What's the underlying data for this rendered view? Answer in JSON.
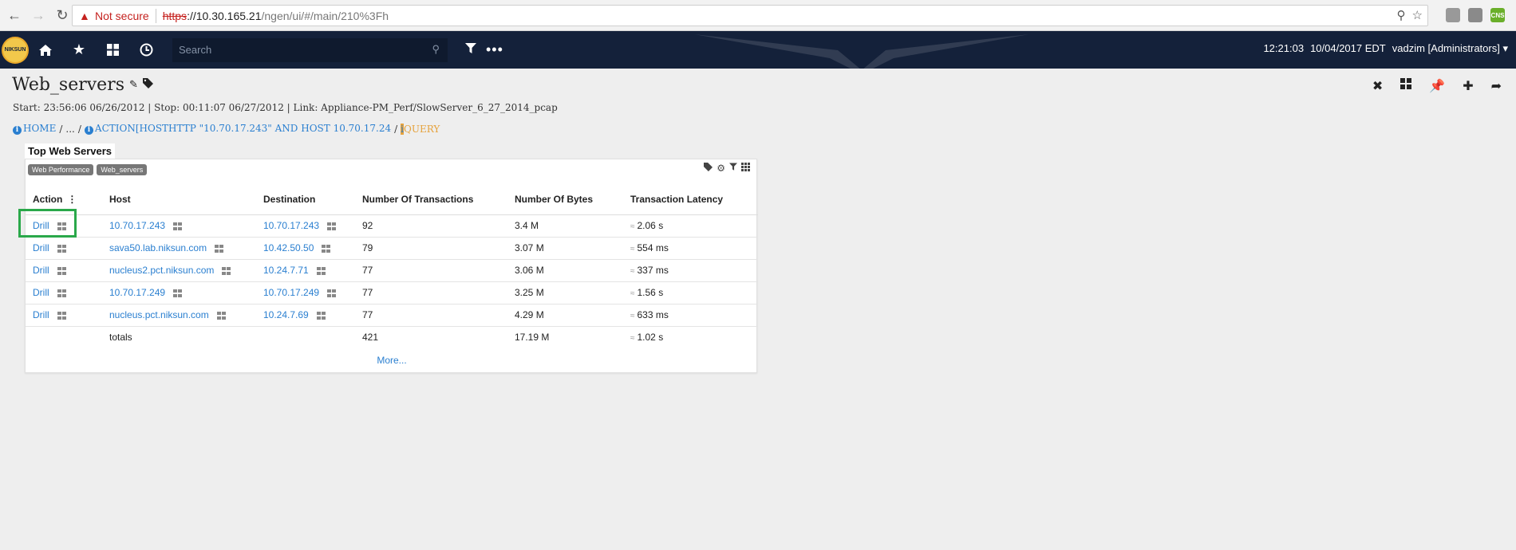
{
  "browser": {
    "not_secure": "Not secure",
    "url_scheme": "https",
    "url_host": "://10.30.165.21",
    "url_path": "/ngen/ui/#/main/210%3Fh",
    "ext_label": "CNS"
  },
  "app": {
    "logo_text": "NIKSUN",
    "search_placeholder": "Search",
    "time": "12:21:03",
    "date": "10/04/2017 EDT",
    "user": "vadzim [Administrators]"
  },
  "page": {
    "title": "Web_servers",
    "subtitle": "Start: 23:56:06 06/26/2012 | Stop: 00:11:07 06/27/2012 | Link: Appliance-PM_Perf/SlowServer_6_27_2014_pcap",
    "breadcrumb": {
      "home": "HOME",
      "ellipsis": "...",
      "action": "ACTION[HOSTHTTP \"10.70.17.243\" AND HOST 10.70.17.24",
      "query": "QUERY"
    }
  },
  "widget": {
    "title": "Top Web Servers",
    "tags": [
      "Web Performance",
      "Web_servers"
    ],
    "columns": [
      "Action",
      "Host",
      "Destination",
      "Number Of Transactions",
      "Number Of Bytes",
      "Transaction Latency"
    ],
    "rows": [
      {
        "action": "Drill",
        "host": "10.70.17.243",
        "destination": "10.70.17.243",
        "transactions": "92",
        "bytes": "3.4 M",
        "latency": "2.06 s"
      },
      {
        "action": "Drill",
        "host": "sava50.lab.niksun.com",
        "destination": "10.42.50.50",
        "transactions": "79",
        "bytes": "3.07 M",
        "latency": "554 ms"
      },
      {
        "action": "Drill",
        "host": "nucleus2.pct.niksun.com",
        "destination": "10.24.7.71",
        "transactions": "77",
        "bytes": "3.06 M",
        "latency": "337 ms"
      },
      {
        "action": "Drill",
        "host": "10.70.17.249",
        "destination": "10.70.17.249",
        "transactions": "77",
        "bytes": "3.25 M",
        "latency": "1.56 s"
      },
      {
        "action": "Drill",
        "host": "nucleus.pct.niksun.com",
        "destination": "10.24.7.69",
        "transactions": "77",
        "bytes": "4.29 M",
        "latency": "633 ms"
      }
    ],
    "totals": {
      "label": "totals",
      "transactions": "421",
      "bytes": "17.19 M",
      "latency": "1.02 s"
    },
    "approx_symbol": "≈",
    "more": "More..."
  }
}
